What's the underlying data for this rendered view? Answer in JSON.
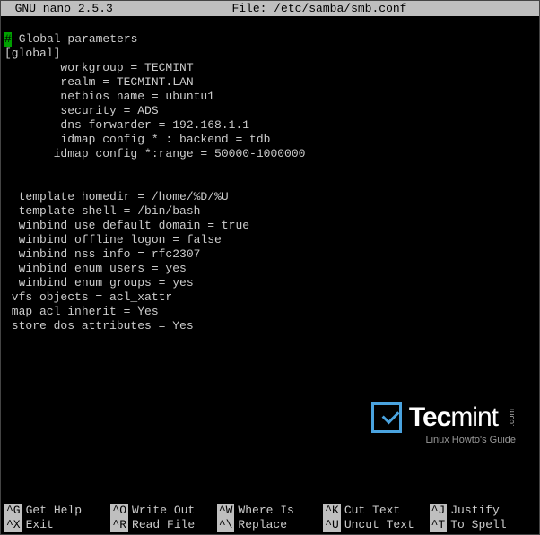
{
  "titlebar": "  GNU nano 2.5.3                 File: /etc/samba/smb.conf                       ",
  "editor_name": "GNU nano",
  "editor_version": "2.5.3",
  "file_path": "/etc/samba/smb.conf",
  "comment_marker": "#",
  "lines": [
    " Global parameters",
    "[global]",
    "        workgroup = TECMINT",
    "        realm = TECMINT.LAN",
    "        netbios name = ubuntu1",
    "        security = ADS",
    "        dns forwarder = 192.168.1.1",
    "        idmap config * : backend = tdb",
    "       idmap config *:range = 50000-1000000",
    "",
    "",
    "  template homedir = /home/%D/%U",
    "  template shell = /bin/bash",
    "  winbind use default domain = true",
    "  winbind offline logon = false",
    "  winbind nss info = rfc2307",
    "  winbind enum users = yes",
    "  winbind enum groups = yes",
    " vfs objects = acl_xattr",
    " map acl inherit = Yes",
    " store dos attributes = Yes"
  ],
  "logo": {
    "brand_a": "Tec",
    "brand_b": "mint",
    "dotcom": ".com",
    "tagline": "Linux Howto's Guide"
  },
  "shortcuts": {
    "row1": [
      {
        "key": "^G",
        "label": "Get Help"
      },
      {
        "key": "^O",
        "label": "Write Out"
      },
      {
        "key": "^W",
        "label": "Where Is"
      },
      {
        "key": "^K",
        "label": "Cut Text"
      },
      {
        "key": "^J",
        "label": "Justify"
      }
    ],
    "row2": [
      {
        "key": "^X",
        "label": "Exit"
      },
      {
        "key": "^R",
        "label": "Read File"
      },
      {
        "key": "^\\",
        "label": "Replace"
      },
      {
        "key": "^U",
        "label": "Uncut Text"
      },
      {
        "key": "^T",
        "label": "To Spell"
      }
    ]
  }
}
